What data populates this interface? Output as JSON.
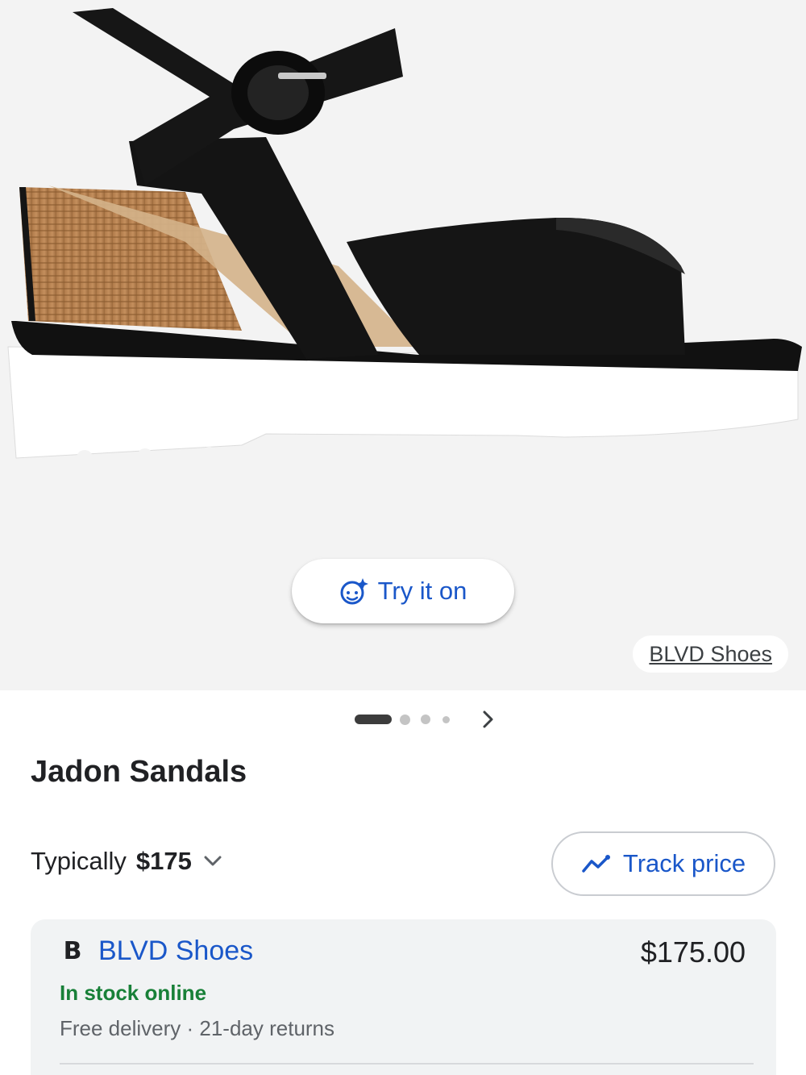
{
  "hero": {
    "image_alt": "black sandal product image",
    "try_on": {
      "label": "Try it on",
      "icon": "face-sparkle-icon"
    },
    "source_label": "BLVD Shoes"
  },
  "carousel": {
    "total_dots": 4,
    "active_index": 0,
    "next_icon": "chevron-right-icon"
  },
  "product": {
    "title": "Jadon Sandals"
  },
  "pricing": {
    "typically_label": "Typically",
    "typical_price": "$175",
    "expand_icon": "chevron-down-icon",
    "track_label": "Track price",
    "track_icon": "trend-line-icon"
  },
  "offer": {
    "merchant_logo": "B",
    "merchant_name": "BLVD Shoes",
    "price": "$175.00",
    "stock": "In stock online",
    "delivery": "Free delivery · 21-day returns"
  },
  "colors": {
    "link_blue": "#1a57c9",
    "stock_green": "#188038",
    "hero_bg": "#f3f3f3",
    "card_bg": "#f1f3f4"
  }
}
